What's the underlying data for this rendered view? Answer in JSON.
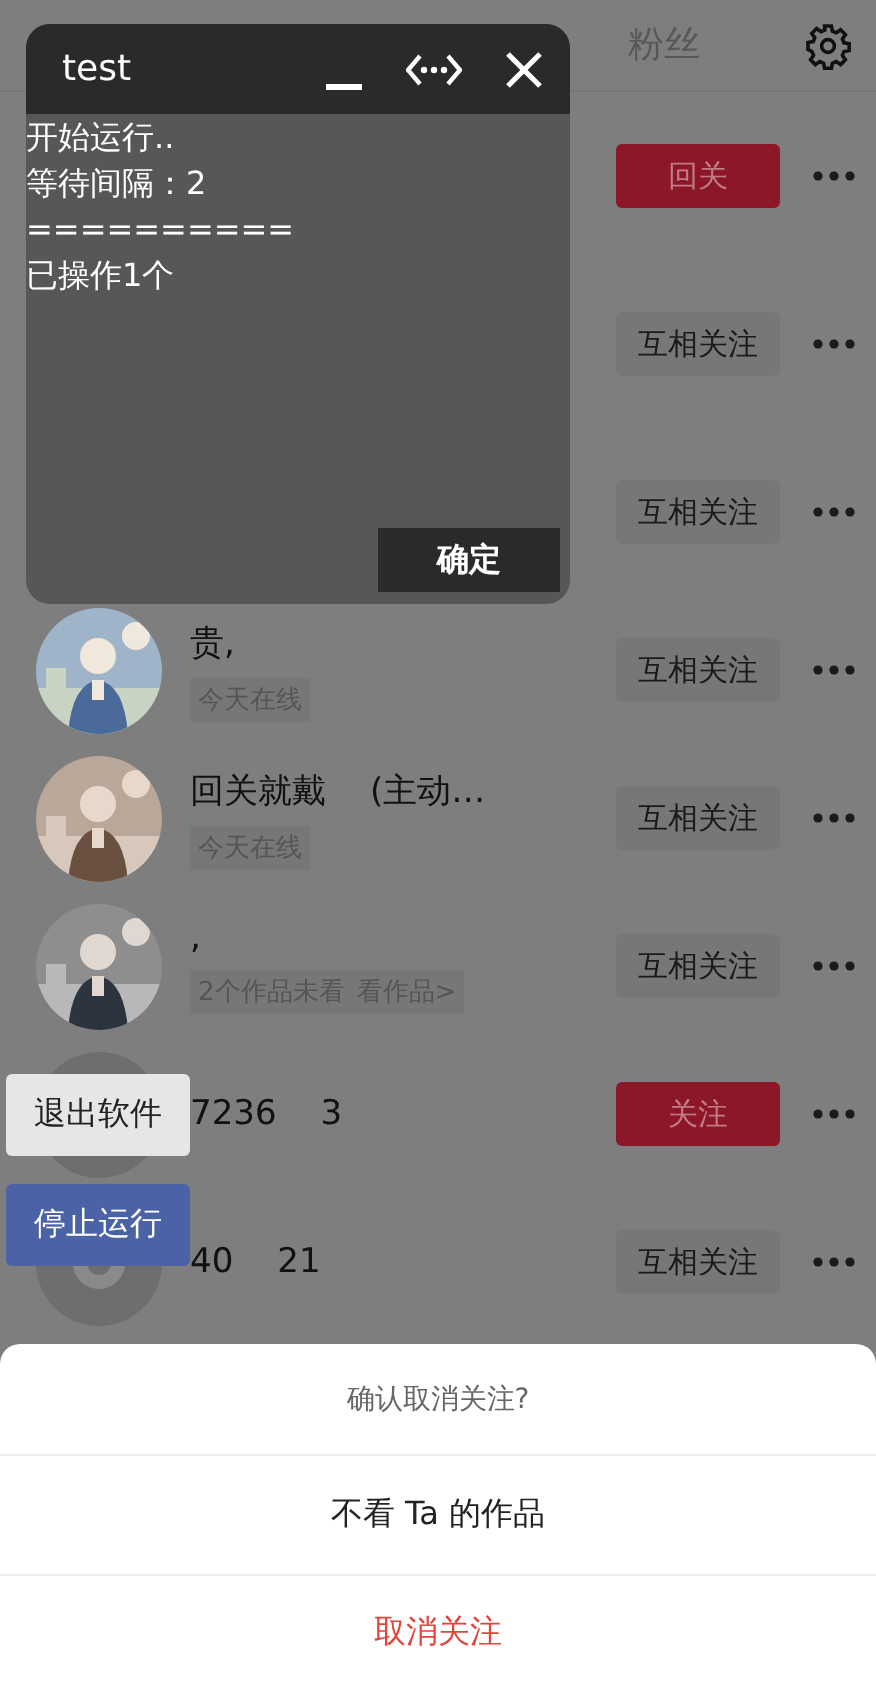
{
  "header": {
    "tabs": [
      {
        "label": "粉丝",
        "selected": false
      }
    ]
  },
  "list": {
    "rows": [
      {
        "button": {
          "label": "回关",
          "kind": "primary"
        }
      },
      {
        "button": {
          "label": "互相关注",
          "kind": "secondary"
        }
      },
      {
        "button": {
          "label": "互相关注",
          "kind": "secondary"
        }
      },
      {
        "name": "贵,",
        "status": "今天在线",
        "button": {
          "label": "互相关注",
          "kind": "secondary"
        }
      },
      {
        "name": "回关就戴",
        "name_tail": "(主动…",
        "status": "今天在线",
        "button": {
          "label": "互相关注",
          "kind": "secondary"
        }
      },
      {
        "name": ",",
        "status": "2个作品未看",
        "status_link": "看作品>",
        "button": {
          "label": "互相关注",
          "kind": "secondary"
        }
      },
      {
        "avatar": {
          "kind": "default"
        },
        "name": "7236",
        "name_tail": "3",
        "button": {
          "label": "关注",
          "kind": "primary"
        }
      },
      {
        "avatar": {
          "kind": "default"
        },
        "name": "40",
        "name_tail": "21",
        "button": {
          "label": "互相关注",
          "kind": "secondary"
        }
      }
    ]
  },
  "float_window": {
    "title": "test",
    "log_lines": [
      "开始运行..",
      "等待间隔：2",
      "==========",
      "已操作1个"
    ],
    "confirm_button": "确定"
  },
  "side_buttons": [
    {
      "label": "退出软件",
      "kind": "light"
    },
    {
      "label": "停止运行",
      "kind": "primary"
    }
  ],
  "action_sheet": {
    "title": "确认取消关注?",
    "options": [
      {
        "label": "不看 Ta 的作品",
        "kind": "normal"
      },
      {
        "label": "取消关注",
        "kind": "destructive"
      }
    ]
  }
}
